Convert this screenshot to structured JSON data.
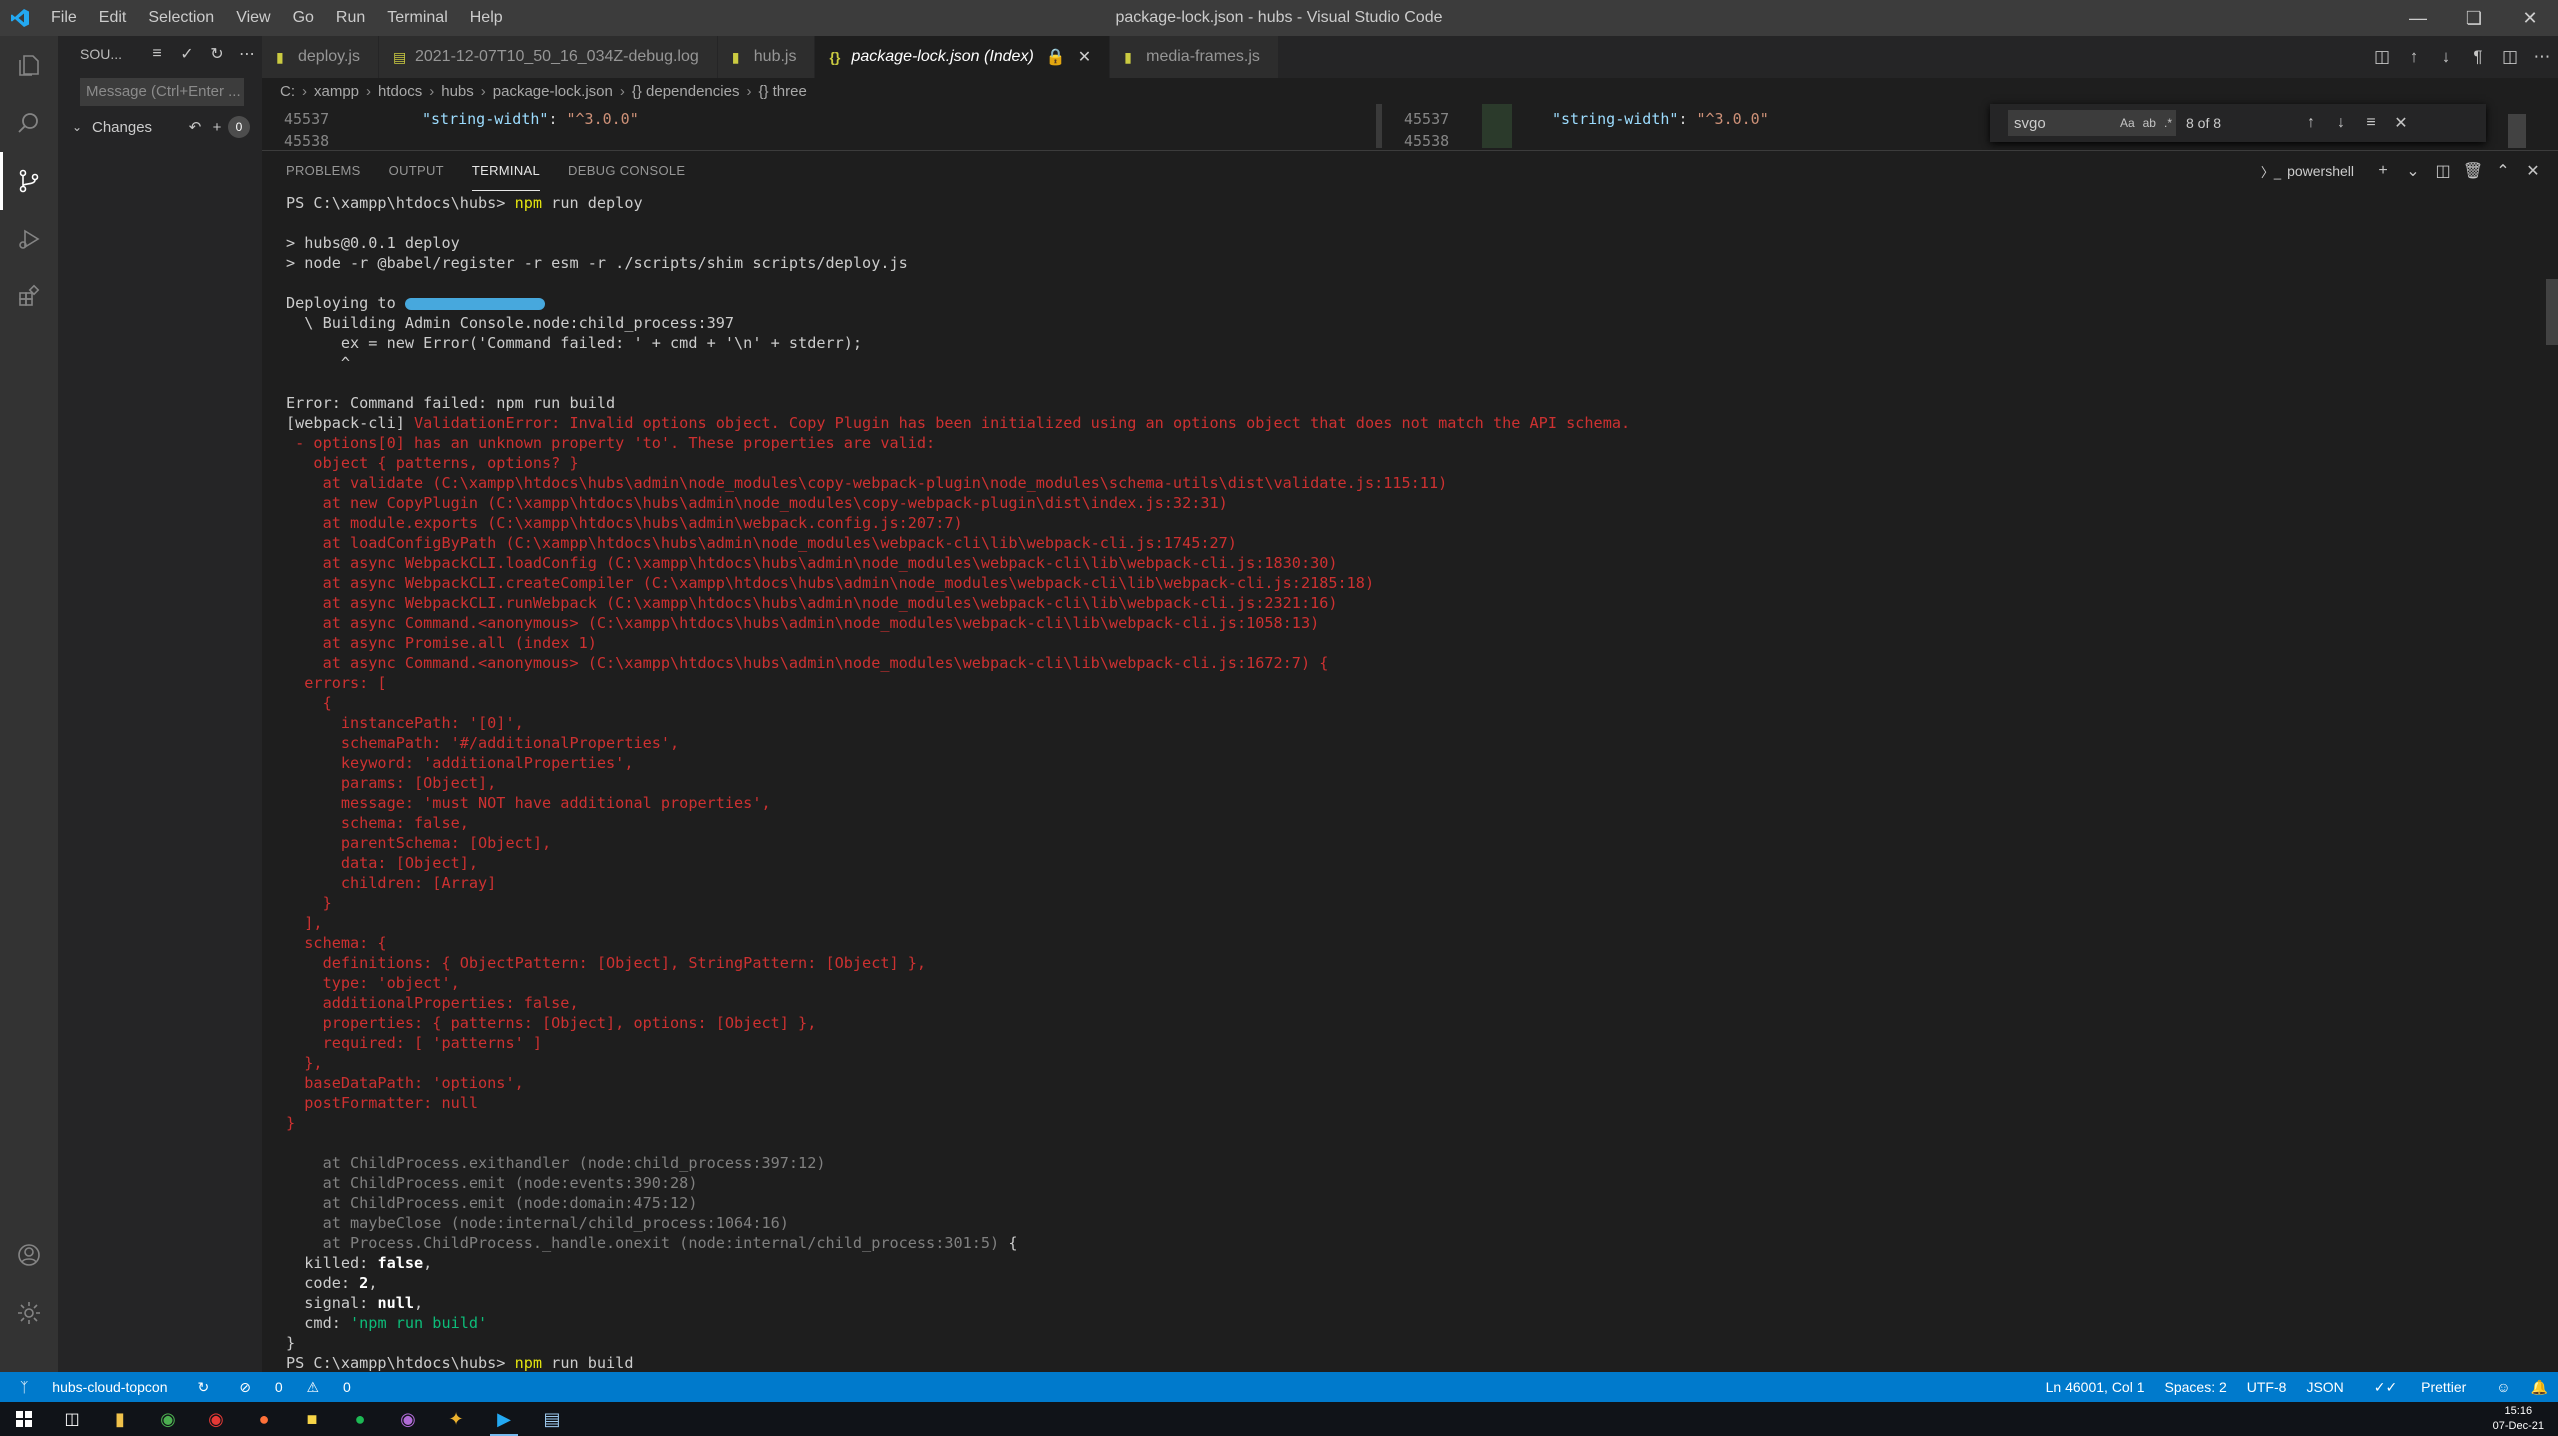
{
  "window": {
    "title": "package-lock.json - hubs - Visual Studio Code",
    "menu": [
      "File",
      "Edit",
      "Selection",
      "View",
      "Go",
      "Run",
      "Terminal",
      "Help"
    ]
  },
  "sidebar": {
    "title": "SOU...",
    "message_placeholder": "Message (Ctrl+Enter ...",
    "changes_label": "Changes",
    "changes_count": "0"
  },
  "tabs": [
    {
      "label": "deploy.js",
      "icon": "js-file-icon"
    },
    {
      "label": "2021-12-07T10_50_16_034Z-debug.log",
      "icon": "log-file-icon"
    },
    {
      "label": "hub.js",
      "icon": "js-file-icon"
    },
    {
      "label": "package-lock.json (Index)",
      "icon": "json-file-icon",
      "active": true
    },
    {
      "label": "media-frames.js",
      "icon": "js-file-icon"
    }
  ],
  "breadcrumb": [
    "C:",
    "xampp",
    "htdocs",
    "hubs",
    "package-lock.json",
    "{} dependencies",
    "{} three"
  ],
  "editor": {
    "left": {
      "line": "45537",
      "key": "\"string-width\"",
      "value": "\"^3.0.0\"",
      "next_line": "45538"
    },
    "right": {
      "line": "45537",
      "key": "\"string-width\"",
      "value": "\"^3.0.0\"",
      "next_line": "45538"
    }
  },
  "find": {
    "value": "svgo",
    "count": "8 of 8"
  },
  "panel": {
    "tabs": [
      "PROBLEMS",
      "OUTPUT",
      "TERMINAL",
      "DEBUG CONSOLE"
    ],
    "active_tab": "TERMINAL",
    "shell": "powershell"
  },
  "terminal": {
    "lines": [
      {
        "parts": [
          {
            "t": "PS C:\\xampp\\htdocs\\hubs> ",
            "c": "w"
          },
          {
            "t": "npm",
            "c": "y"
          },
          {
            "t": " run deploy",
            "c": "w"
          }
        ]
      },
      {
        "parts": []
      },
      {
        "parts": [
          {
            "t": "> hubs@0.0.1 deploy",
            "c": "w"
          }
        ]
      },
      {
        "parts": [
          {
            "t": "> node -r @babel/register -r esm -r ./scripts/shim scripts/deploy.js",
            "c": "w"
          }
        ]
      },
      {
        "parts": []
      },
      {
        "parts": [
          {
            "t": "Deploying to ",
            "c": "w"
          },
          {
            "t": "",
            "c": "redact"
          }
        ]
      },
      {
        "parts": [
          {
            "t": "  \\ ",
            "c": "w"
          },
          {
            "t": "Building Admin Console.node:child_process:397",
            "c": "w"
          }
        ]
      },
      {
        "parts": [
          {
            "t": "      ex = new Error('Command failed: ' + cmd + '\\n' + stderr);",
            "c": "w"
          }
        ]
      },
      {
        "parts": [
          {
            "t": "      ^",
            "c": "w"
          }
        ]
      },
      {
        "parts": []
      },
      {
        "parts": [
          {
            "t": "Error: Command failed: npm run build",
            "c": "w"
          }
        ]
      },
      {
        "parts": [
          {
            "t": "[webpack-cli] ",
            "c": "w"
          },
          {
            "t": "ValidationError: Invalid options object. Copy Plugin has been initialized using an options object that does not match the API schema.",
            "c": "r"
          }
        ]
      },
      {
        "parts": [
          {
            "t": " - options[0] has an unknown property 'to'. These properties are valid:",
            "c": "r"
          }
        ]
      },
      {
        "parts": [
          {
            "t": "   object { patterns, options? }",
            "c": "r"
          }
        ]
      },
      {
        "parts": [
          {
            "t": "    at validate (C:\\xampp\\htdocs\\hubs\\admin\\node_modules\\copy-webpack-plugin\\node_modules\\schema-utils\\dist\\validate.js:115:11)",
            "c": "r"
          }
        ]
      },
      {
        "parts": [
          {
            "t": "    at new CopyPlugin (C:\\xampp\\htdocs\\hubs\\admin\\node_modules\\copy-webpack-plugin\\dist\\index.js:32:31)",
            "c": "r"
          }
        ]
      },
      {
        "parts": [
          {
            "t": "    at module.exports (C:\\xampp\\htdocs\\hubs\\admin\\webpack.config.js:207:7)",
            "c": "r"
          }
        ]
      },
      {
        "parts": [
          {
            "t": "    at loadConfigByPath (C:\\xampp\\htdocs\\hubs\\admin\\node_modules\\webpack-cli\\lib\\webpack-cli.js:1745:27)",
            "c": "r"
          }
        ]
      },
      {
        "parts": [
          {
            "t": "    at async WebpackCLI.loadConfig (C:\\xampp\\htdocs\\hubs\\admin\\node_modules\\webpack-cli\\lib\\webpack-cli.js:1830:30)",
            "c": "r"
          }
        ]
      },
      {
        "parts": [
          {
            "t": "    at async WebpackCLI.createCompiler (C:\\xampp\\htdocs\\hubs\\admin\\node_modules\\webpack-cli\\lib\\webpack-cli.js:2185:18)",
            "c": "r"
          }
        ]
      },
      {
        "parts": [
          {
            "t": "    at async WebpackCLI.runWebpack (C:\\xampp\\htdocs\\hubs\\admin\\node_modules\\webpack-cli\\lib\\webpack-cli.js:2321:16)",
            "c": "r"
          }
        ]
      },
      {
        "parts": [
          {
            "t": "    at async Command.<anonymous> (C:\\xampp\\htdocs\\hubs\\admin\\node_modules\\webpack-cli\\lib\\webpack-cli.js:1058:13)",
            "c": "r"
          }
        ]
      },
      {
        "parts": [
          {
            "t": "    at async Promise.all (index 1)",
            "c": "r"
          }
        ]
      },
      {
        "parts": [
          {
            "t": "    at async Command.<anonymous> (C:\\xampp\\htdocs\\hubs\\admin\\node_modules\\webpack-cli\\lib\\webpack-cli.js:1672:7) {",
            "c": "r"
          }
        ]
      },
      {
        "parts": [
          {
            "t": "  errors: [",
            "c": "r"
          }
        ]
      },
      {
        "parts": [
          {
            "t": "    {",
            "c": "r"
          }
        ]
      },
      {
        "parts": [
          {
            "t": "      instancePath: '[0]',",
            "c": "r"
          }
        ]
      },
      {
        "parts": [
          {
            "t": "      schemaPath: '#/additionalProperties',",
            "c": "r"
          }
        ]
      },
      {
        "parts": [
          {
            "t": "      keyword: 'additionalProperties',",
            "c": "r"
          }
        ]
      },
      {
        "parts": [
          {
            "t": "      params: [Object],",
            "c": "r"
          }
        ]
      },
      {
        "parts": [
          {
            "t": "      message: 'must NOT have additional properties',",
            "c": "r"
          }
        ]
      },
      {
        "parts": [
          {
            "t": "      schema: false,",
            "c": "r"
          }
        ]
      },
      {
        "parts": [
          {
            "t": "      parentSchema: [Object],",
            "c": "r"
          }
        ]
      },
      {
        "parts": [
          {
            "t": "      data: [Object],",
            "c": "r"
          }
        ]
      },
      {
        "parts": [
          {
            "t": "      children: [Array]",
            "c": "r"
          }
        ]
      },
      {
        "parts": [
          {
            "t": "    }",
            "c": "r"
          }
        ]
      },
      {
        "parts": [
          {
            "t": "  ],",
            "c": "r"
          }
        ]
      },
      {
        "parts": [
          {
            "t": "  schema: {",
            "c": "r"
          }
        ]
      },
      {
        "parts": [
          {
            "t": "    definitions: { ObjectPattern: [Object], StringPattern: [Object] },",
            "c": "r"
          }
        ]
      },
      {
        "parts": [
          {
            "t": "    type: 'object',",
            "c": "r"
          }
        ]
      },
      {
        "parts": [
          {
            "t": "    additionalProperties: false,",
            "c": "r"
          }
        ]
      },
      {
        "parts": [
          {
            "t": "    properties: { patterns: [Object], options: [Object] },",
            "c": "r"
          }
        ]
      },
      {
        "parts": [
          {
            "t": "    required: [ 'patterns' ]",
            "c": "r"
          }
        ]
      },
      {
        "parts": [
          {
            "t": "  },",
            "c": "r"
          }
        ]
      },
      {
        "parts": [
          {
            "t": "  baseDataPath: 'options',",
            "c": "r"
          }
        ]
      },
      {
        "parts": [
          {
            "t": "  postFormatter: null",
            "c": "r"
          }
        ]
      },
      {
        "parts": [
          {
            "t": "}",
            "c": "r"
          }
        ]
      },
      {
        "parts": []
      },
      {
        "parts": [
          {
            "t": "    at ChildProcess.exithandler (node:child_process:397:12)",
            "c": "g"
          }
        ]
      },
      {
        "parts": [
          {
            "t": "    at ChildProcess.emit (node:events:390:28)",
            "c": "g"
          }
        ]
      },
      {
        "parts": [
          {
            "t": "    at ChildProcess.emit (node:domain:475:12)",
            "c": "g"
          }
        ]
      },
      {
        "parts": [
          {
            "t": "    at maybeClose (node:internal/child_process:1064:16)",
            "c": "g"
          }
        ]
      },
      {
        "parts": [
          {
            "t": "    at Process.ChildProcess._handle.onexit (node:internal/child_process:301:5)",
            "c": "g"
          },
          {
            "t": " {",
            "c": "w"
          }
        ]
      },
      {
        "parts": [
          {
            "t": "  killed: ",
            "c": "w"
          },
          {
            "t": "false",
            "c": "b"
          },
          {
            "t": ",",
            "c": "w"
          }
        ]
      },
      {
        "parts": [
          {
            "t": "  code: ",
            "c": "w"
          },
          {
            "t": "2",
            "c": "b"
          },
          {
            "t": ",",
            "c": "w"
          }
        ]
      },
      {
        "parts": [
          {
            "t": "  signal: ",
            "c": "w"
          },
          {
            "t": "null",
            "c": "b"
          },
          {
            "t": ",",
            "c": "w"
          }
        ]
      },
      {
        "parts": [
          {
            "t": "  cmd: ",
            "c": "w"
          },
          {
            "t": "'npm run build'",
            "c": "gr"
          }
        ]
      },
      {
        "parts": [
          {
            "t": "}",
            "c": "w"
          }
        ]
      },
      {
        "parts": [
          {
            "t": "PS C:\\xampp\\htdocs\\hubs> ",
            "c": "w"
          },
          {
            "t": "npm",
            "c": "y"
          },
          {
            "t": " run build",
            "c": "w"
          }
        ]
      }
    ]
  },
  "statusbar": {
    "branch": "hubs-cloud-topcon",
    "errors": "0",
    "warnings": "0",
    "position": "Ln 46001, Col 1",
    "spaces": "Spaces: 2",
    "encoding": "UTF-8",
    "language": "JSON",
    "formatter": "Prettier"
  },
  "taskbar": {
    "time": "15:16",
    "date": "07-Dec-21"
  }
}
